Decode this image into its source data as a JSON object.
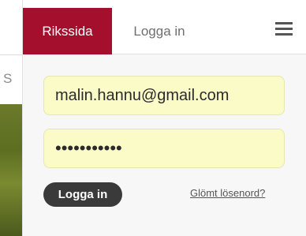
{
  "background": {
    "partial_text": "S"
  },
  "nav": {
    "riksida_tab": "Rikssida",
    "login_tab": "Logga in",
    "menu_icon": "hamburger-menu-icon",
    "accent_color": "#a30f2d"
  },
  "login": {
    "email_value": "malin.hannu@gmail.com",
    "password_value": "•••••••••••",
    "submit_label": "Logga in",
    "forgot_label": "Glömt lösenord?"
  }
}
